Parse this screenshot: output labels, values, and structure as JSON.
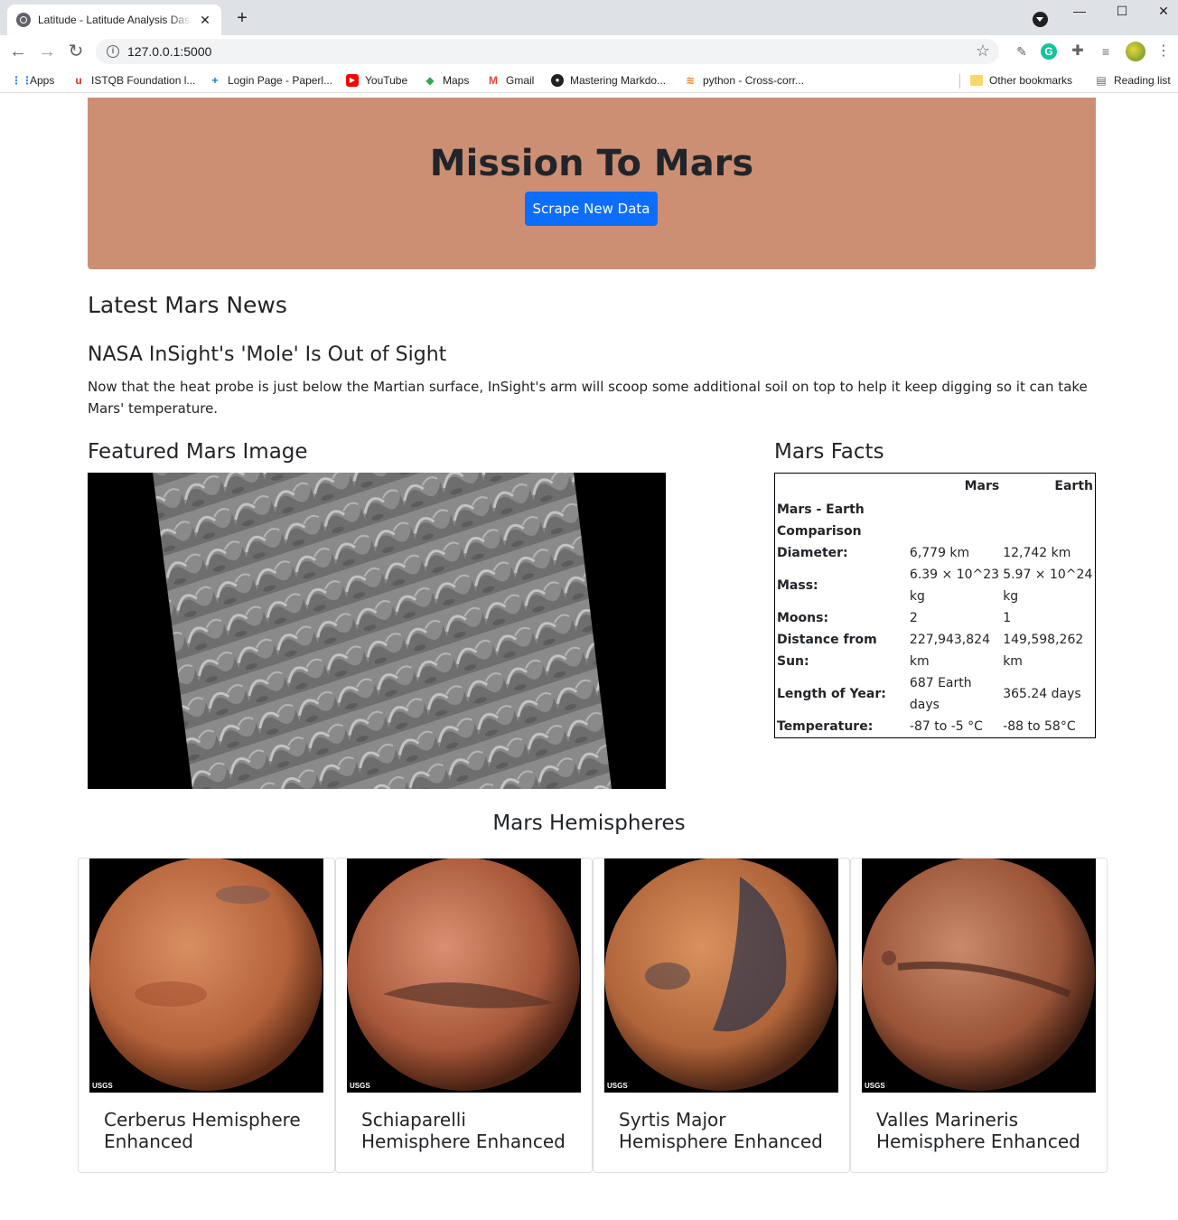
{
  "browser": {
    "tab_title": "Latitude - Latitude Analysis Dashboard",
    "url": "127.0.0.1:5000",
    "bookmarks": [
      "Apps",
      "ISTQB Foundation l...",
      "Login Page - Paperl...",
      "YouTube",
      "Maps",
      "Gmail",
      "Mastering Markdo...",
      "python - Cross-corr..."
    ],
    "other_bookmarks": "Other bookmarks",
    "reading_list": "Reading list"
  },
  "jumbotron": {
    "title": "Mission To Mars",
    "button": "Scrape New Data",
    "bg_color": "#cd8f74",
    "button_color": "#0d6efd"
  },
  "news": {
    "heading": "Latest Mars News",
    "title": "NASA InSight's 'Mole' Is Out of Sight",
    "paragraph": "Now that the heat probe is just below the Martian surface, InSight's arm will scoop some additional soil on top to help it keep digging so it can take Mars' temperature."
  },
  "featured": {
    "heading": "Featured Mars Image"
  },
  "facts": {
    "heading": "Mars Facts",
    "col_mars": "Mars",
    "col_earth": "Earth",
    "rows": [
      {
        "label": "Mars - Earth Comparison",
        "mars": "",
        "earth": ""
      },
      {
        "label": "Diameter:",
        "mars": "6,779 km",
        "earth": "12,742 km"
      },
      {
        "label": "Mass:",
        "mars": "6.39 × 10^23 kg",
        "earth": "5.97 × 10^24 kg"
      },
      {
        "label": "Moons:",
        "mars": "2",
        "earth": "1"
      },
      {
        "label": "Distance from Sun:",
        "mars": "227,943,824 km",
        "earth": "149,598,262 km"
      },
      {
        "label": "Length of Year:",
        "mars": "687 Earth days",
        "earth": "365.24 days"
      },
      {
        "label": "Temperature:",
        "mars": "-87 to -5 °C",
        "earth": "-88 to 58°C"
      }
    ]
  },
  "hemispheres": {
    "heading": "Mars Hemispheres",
    "items": [
      {
        "title": "Cerberus Hemisphere Enhanced"
      },
      {
        "title": "Schiaparelli Hemisphere Enhanced"
      },
      {
        "title": "Syrtis Major Hemisphere Enhanced"
      },
      {
        "title": "Valles Marineris Hemisphere Enhanced"
      }
    ],
    "logo_text": "USGS"
  }
}
